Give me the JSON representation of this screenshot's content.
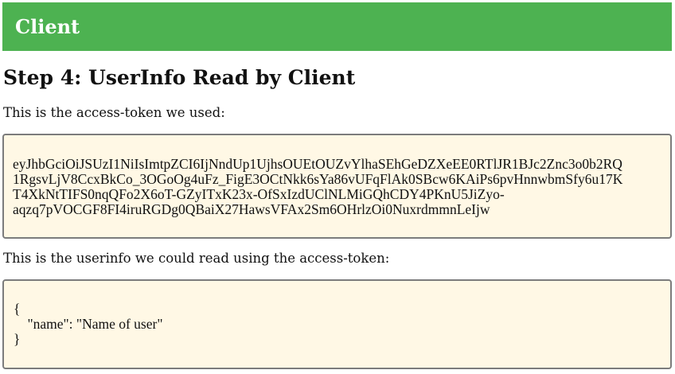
{
  "header": {
    "title": "Client",
    "color": "#4db251"
  },
  "step": {
    "title": "Step 4: UserInfo Read by Client"
  },
  "access_token": {
    "label": "This is the access-token we used:",
    "lines": [
      "eyJhbGciOiJSUzI1NiIsImtpZCI6IjNndUp1UjhsOUEtOUZvYlhaSEhGeDZXeEE0RTlJR1BJc2Znc3o0b2RQ",
      "1RgsvLjV8CcxBkCo_3OGoOg4uFz_FigE3OCtNkk6sYa86vUFqFlAk0SBcw6KAiPs6pvHnnwbmSfy6u17K",
      "T4XkNtTIFS0nqQFo2X6oT-GZyITxK23x-OfSxIzdUClNLMiGQhCDY4PKnU5JiZyo-",
      "aqzq7pVOCGF8FI4iruRGDg0QBaiX27HawsVFAx2Sm6OHrlzOi0NuxrdmmnLeIjw"
    ]
  },
  "userinfo": {
    "label": "This is the userinfo we could read using the access-token:",
    "lines": [
      "{",
      "    \"name\": \"Name of user\"",
      "}"
    ]
  }
}
